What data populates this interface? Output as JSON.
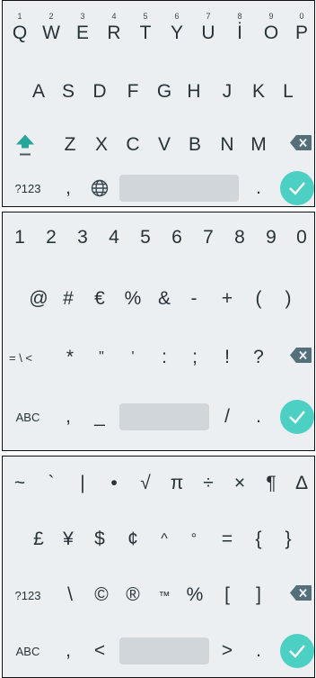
{
  "alpha_keyboard": {
    "row1": [
      {
        "label": "Q",
        "hint": "1"
      },
      {
        "label": "W",
        "hint": "2"
      },
      {
        "label": "E",
        "hint": "3"
      },
      {
        "label": "R",
        "hint": "4"
      },
      {
        "label": "T",
        "hint": "5"
      },
      {
        "label": "Y",
        "hint": "6"
      },
      {
        "label": "U",
        "hint": "7"
      },
      {
        "label": "İ",
        "hint": "8"
      },
      {
        "label": "O",
        "hint": "9"
      },
      {
        "label": "P",
        "hint": "0"
      }
    ],
    "row2": [
      "A",
      "S",
      "D",
      "F",
      "G",
      "H",
      "J",
      "K",
      "L"
    ],
    "row3": [
      "Z",
      "X",
      "C",
      "V",
      "B",
      "N",
      "M"
    ],
    "bottom": {
      "symbols_key": "?123",
      "comma": ",",
      "period": "."
    },
    "icons": {
      "shift": "shift-up-arrow-icon",
      "delete": "backspace-icon",
      "globe": "globe-icon",
      "enter": "checkmark-icon"
    },
    "accent_color": "#26a69a"
  },
  "symbols_keyboard": {
    "row1": [
      "1",
      "2",
      "3",
      "4",
      "5",
      "6",
      "7",
      "8",
      "9",
      "0"
    ],
    "row2": [
      "@",
      "#",
      "€",
      "%",
      "&",
      "-",
      "+",
      "(",
      ")"
    ],
    "row3": [
      "*",
      "\"",
      "'",
      ":",
      ";",
      "!",
      "?"
    ],
    "more_symbols_key": "= \\ <",
    "bottom": {
      "alpha_key": "ABC",
      "comma": ",",
      "underscore": "_",
      "slash": "/",
      "period": "."
    }
  },
  "more_symbols_keyboard": {
    "row1": [
      "~",
      "`",
      "|",
      "•",
      "√",
      "π",
      "÷",
      "×",
      "¶",
      "∆"
    ],
    "row2": [
      "£",
      "¥",
      "$",
      "¢",
      "^",
      "°",
      "=",
      "{",
      "}"
    ],
    "row3": [
      "\\",
      "©",
      "®",
      "™",
      "%",
      "[",
      "]"
    ],
    "symbols_key": "?123",
    "bottom": {
      "alpha_key": "ABC",
      "comma": ",",
      "less_than": "<",
      "greater_than": ">",
      "period": "."
    }
  },
  "colors": {
    "background": "#eceff1",
    "key_text": "#263238",
    "enter": "#4dd0c4",
    "spacebar": "#d0d6da"
  }
}
